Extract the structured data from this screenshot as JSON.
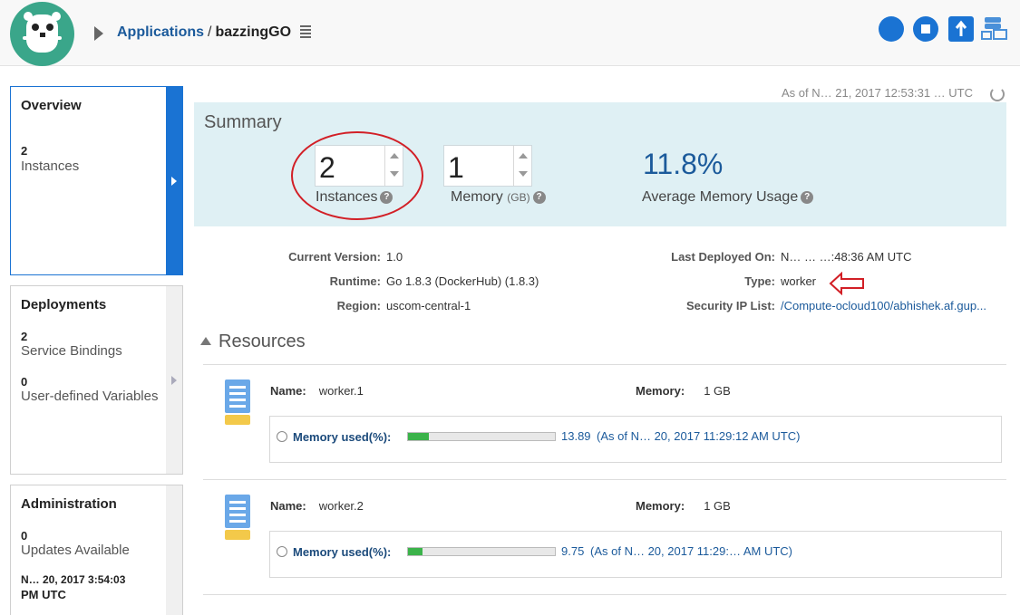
{
  "header": {
    "breadcrumb_root": "Applications",
    "breadcrumb_sep": "/",
    "breadcrumb_current": "bazzingGO",
    "action_icons": [
      "start-icon",
      "stop-icon",
      "restart-icon",
      "deploy-icon"
    ]
  },
  "sidebar": {
    "overview": {
      "title": "Overview",
      "count": "2",
      "label": "Instances"
    },
    "deployments": {
      "title": "Deployments",
      "count1": "2",
      "label1": "Service Bindings",
      "count2": "0",
      "label2": "User-defined Variables"
    },
    "administration": {
      "title": "Administration",
      "count": "0",
      "label": "Updates Available",
      "date_line1": "N… 20, 2017 3:54:03",
      "date_line2": "PM UTC"
    }
  },
  "main": {
    "as_of": "As of N… 21, 2017 12:53:31 … UTC",
    "summary": {
      "title": "Summary",
      "instances_value": "2",
      "instances_label": "Instances",
      "memory_value": "1",
      "memory_label": "Memory",
      "memory_unit": "(GB)",
      "avg_value": "11.8%",
      "avg_label": "Average Memory Usage"
    },
    "info": {
      "current_version_label": "Current Version:",
      "current_version": "1.0",
      "runtime_label": "Runtime:",
      "runtime": "Go 1.8.3 (DockerHub) (1.8.3)",
      "region_label": "Region:",
      "region": "uscom-central-1",
      "last_deployed_label": "Last Deployed On:",
      "last_deployed": "N… … …:48:36 AM UTC",
      "type_label": "Type:",
      "type": "worker",
      "security_label": "Security IP List:",
      "security": "/Compute-ocloud100/abhishek.af.gup..."
    },
    "resources": {
      "title": "Resources",
      "items": [
        {
          "name_label": "Name:",
          "name": "worker.1",
          "memory_label": "Memory:",
          "memory": "1 GB",
          "mem_used_label": "Memory used(%):",
          "mem_used_value": "13.89",
          "mem_used_pct": 13.89,
          "as_of": "(As of N… 20, 2017 11:29:12 AM UTC)"
        },
        {
          "name_label": "Name:",
          "name": "worker.2",
          "memory_label": "Memory:",
          "memory": "1 GB",
          "mem_used_label": "Memory used(%):",
          "mem_used_value": "9.75",
          "mem_used_pct": 9.75,
          "as_of": "(As of N… 20, 2017 11:29:… AM UTC)"
        }
      ]
    }
  }
}
